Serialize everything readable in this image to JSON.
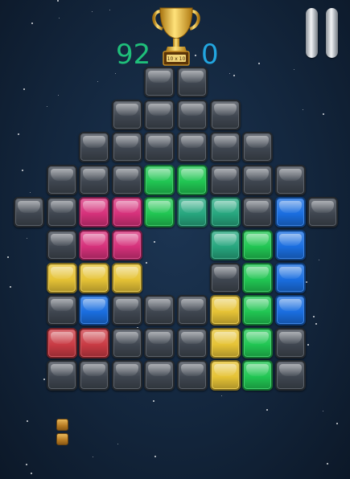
{
  "hud": {
    "score_current": "92",
    "score_best": "0",
    "trophy_plate_text": "10 x 10",
    "pause_icon": "pause-icon",
    "trophy_icon": "trophy-icon"
  },
  "colors": {
    "gray": "#3f4650",
    "green": "#21c653",
    "teal": "#27a77f",
    "magenta": "#d6317b",
    "blue": "#1a6ee0",
    "yellow": "#e6c336",
    "red": "#c93b44",
    "score_green": "#1fbf7a",
    "score_blue": "#22a6e0"
  },
  "board": {
    "rows": [
      [
        [
          "gray",
          4
        ],
        [
          "gray",
          5
        ]
      ],
      [
        [
          "gray",
          3
        ],
        [
          "gray",
          4
        ],
        [
          "gray",
          5
        ],
        [
          "gray",
          6
        ]
      ],
      [
        [
          "gray",
          2
        ],
        [
          "gray",
          3
        ],
        [
          "gray",
          4
        ],
        [
          "gray",
          5
        ],
        [
          "gray",
          6
        ],
        [
          "gray",
          7
        ]
      ],
      [
        [
          "gray",
          1
        ],
        [
          "gray",
          2
        ],
        [
          "gray",
          3
        ],
        [
          "green",
          4
        ],
        [
          "green",
          5
        ],
        [
          "gray",
          6
        ],
        [
          "gray",
          7
        ],
        [
          "gray",
          8
        ]
      ],
      [
        [
          "gray",
          0
        ],
        [
          "gray",
          1
        ],
        [
          "magenta",
          2
        ],
        [
          "magenta",
          3
        ],
        [
          "green",
          4
        ],
        [
          "teal",
          5
        ],
        [
          "teal",
          6
        ],
        [
          "gray",
          7
        ],
        [
          "blue",
          8
        ],
        [
          "gray",
          9
        ]
      ],
      [
        [
          "gray",
          1
        ],
        [
          "magenta",
          2
        ],
        [
          "magenta",
          3
        ],
        [
          "teal",
          6
        ],
        [
          "green",
          7
        ],
        [
          "blue",
          8
        ]
      ],
      [
        [
          "yellow",
          1
        ],
        [
          "yellow",
          2
        ],
        [
          "yellow",
          3
        ],
        [
          "gray",
          6
        ],
        [
          "green",
          7
        ],
        [
          "blue",
          8
        ]
      ],
      [
        [
          "gray",
          1
        ],
        [
          "blue",
          2
        ],
        [
          "gray",
          3
        ],
        [
          "gray",
          4
        ],
        [
          "gray",
          5
        ],
        [
          "yellow",
          6
        ],
        [
          "green",
          7
        ],
        [
          "blue",
          8
        ]
      ],
      [
        [
          "red",
          1
        ],
        [
          "red",
          2
        ],
        [
          "gray",
          3
        ],
        [
          "gray",
          4
        ],
        [
          "gray",
          5
        ],
        [
          "yellow",
          6
        ],
        [
          "green",
          7
        ],
        [
          "gray",
          8
        ]
      ],
      [
        [
          "gray",
          1
        ],
        [
          "gray",
          2
        ],
        [
          "gray",
          3
        ],
        [
          "gray",
          4
        ],
        [
          "gray",
          5
        ],
        [
          "yellow",
          6
        ],
        [
          "green",
          7
        ],
        [
          "gray",
          8
        ]
      ]
    ]
  },
  "tray": {
    "pieces": [
      {
        "name": "vertical-two-block",
        "color": "#c8902f",
        "cells": [
          [
            0,
            0
          ],
          [
            1,
            0
          ]
        ]
      }
    ]
  }
}
